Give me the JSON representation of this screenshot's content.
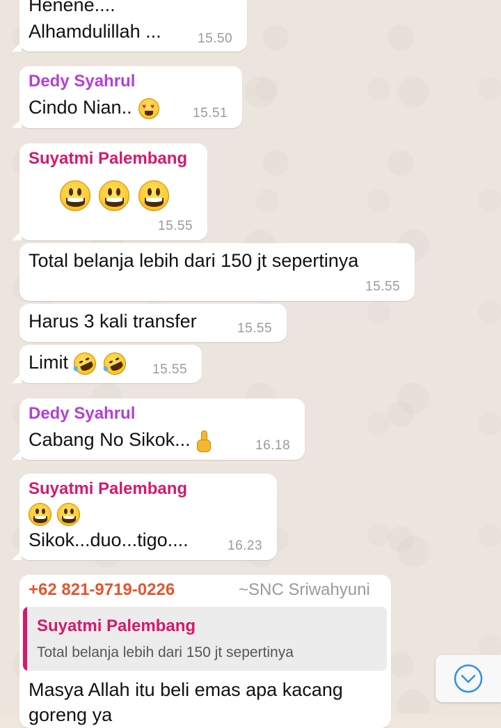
{
  "colors": {
    "sender_dedy": "#b23fd8",
    "sender_suyatmi": "#d6196b",
    "sender_phone": "#e8542f",
    "time": "#9a9a9a",
    "accent_blue": "#2f8fe6"
  },
  "messages": [
    {
      "text_top": "Henene....",
      "text": "Alhamdulillah ...",
      "time": "15.50"
    },
    {
      "sender": "Dedy Syahrul",
      "text": "Cindo Nian..",
      "emoji": "heart-eyes-emoji",
      "time": "15.51"
    },
    {
      "sender": "Suyatmi Palembang",
      "emoji": "grinning-emoji x3",
      "time": "15.55"
    },
    {
      "text": "Total belanja lebih dari 150 jt sepertinya",
      "time": "15.55"
    },
    {
      "text": "Harus 3 kali transfer",
      "time": "15.55"
    },
    {
      "text": "Limit",
      "emoji": "rofl-emoji x2",
      "time": "15.55"
    },
    {
      "sender": "Dedy Syahrul",
      "text": "Cabang No Sikok...",
      "emoji": "pointing-up-emoji",
      "time": "16.18"
    },
    {
      "sender": "Suyatmi Palembang",
      "emoji": "grinning-emoji x2",
      "text": "Sikok...duo...tigo....",
      "time": "16.23"
    },
    {
      "sender": "+62 821-9719-0226",
      "sender_alias": "~SNC Sriwahyuni",
      "quote": {
        "sender": "Suyatmi Palembang",
        "text": "Total belanja lebih dari 150 jt sepertinya"
      },
      "text": "Masya Allah itu beli emas apa kacang",
      "text_cont": "goreng ya"
    }
  ],
  "scroll_button": {
    "icon": "chevron-down-circle-icon"
  }
}
